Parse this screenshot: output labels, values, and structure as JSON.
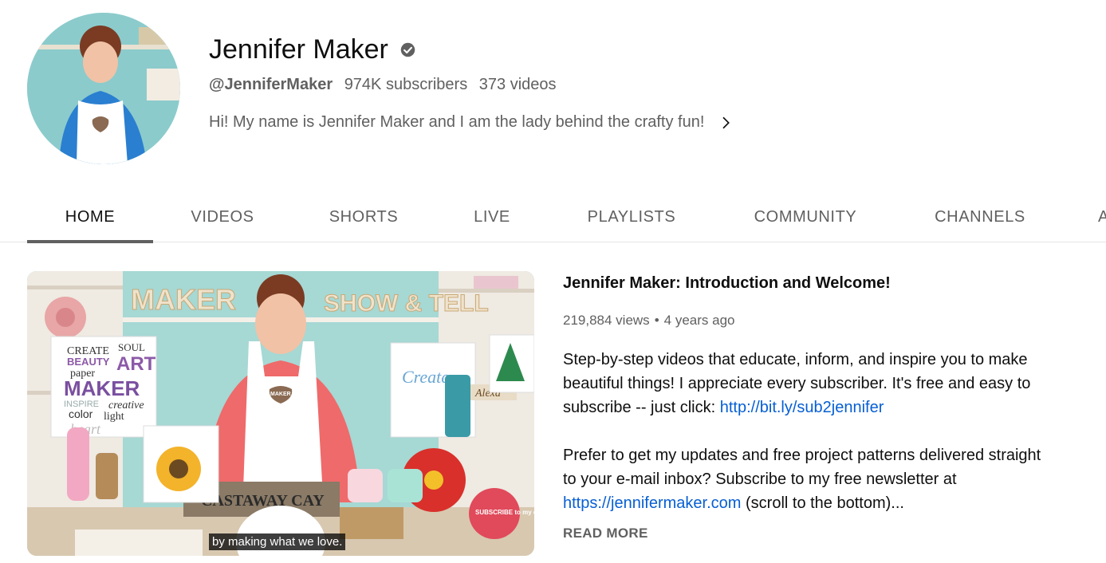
{
  "channel": {
    "name": "Jennifer Maker",
    "handle": "@JenniferMaker",
    "subscribers": "974K subscribers",
    "videos": "373 videos",
    "description": "Hi! My name is Jennifer Maker and I am the lady behind the crafty fun!"
  },
  "tabs": [
    {
      "label": "HOME",
      "active": true
    },
    {
      "label": "VIDEOS"
    },
    {
      "label": "SHORTS"
    },
    {
      "label": "LIVE"
    },
    {
      "label": "PLAYLISTS"
    },
    {
      "label": "COMMUNITY"
    },
    {
      "label": "CHANNELS"
    },
    {
      "label": "A"
    }
  ],
  "featured": {
    "title": "Jennifer Maker: Introduction and Welcome!",
    "views": "219,884 views",
    "age": "4 years ago",
    "desc1": "Step-by-step videos that educate, inform, and inspire you to make beautiful things! I appreciate every subscriber. It's free and easy to subscribe -- just click: ",
    "link1": "http://bit.ly/sub2jennifer",
    "desc2": "Prefer to get my updates and free project patterns delivered straight to your e-mail inbox? Subscribe to my free newsletter at ",
    "link2": "https://jennifermaker.com",
    "desc2_tail": " (scroll to the bottom)...",
    "read_more": "READ MORE",
    "caption": "by making what we love.",
    "thumb_texts": {
      "sign_maker": "MAKER",
      "sign_show": "SHOW & TELL",
      "apron_logo": "MAKER",
      "castaway": "CASTAWAY CAY",
      "subscribe": "SUBSCRIBE to my channel",
      "alexa": "Alexa",
      "words": [
        "CREATE",
        "SOUL",
        "BEAUTY",
        "ART",
        "paper",
        "MAKER",
        "INSPIRE",
        "color",
        "creative",
        "light",
        "heart"
      ]
    }
  },
  "colors": {
    "text_primary": "#0f0f0f",
    "text_secondary": "#606060",
    "link": "#065fd4"
  }
}
